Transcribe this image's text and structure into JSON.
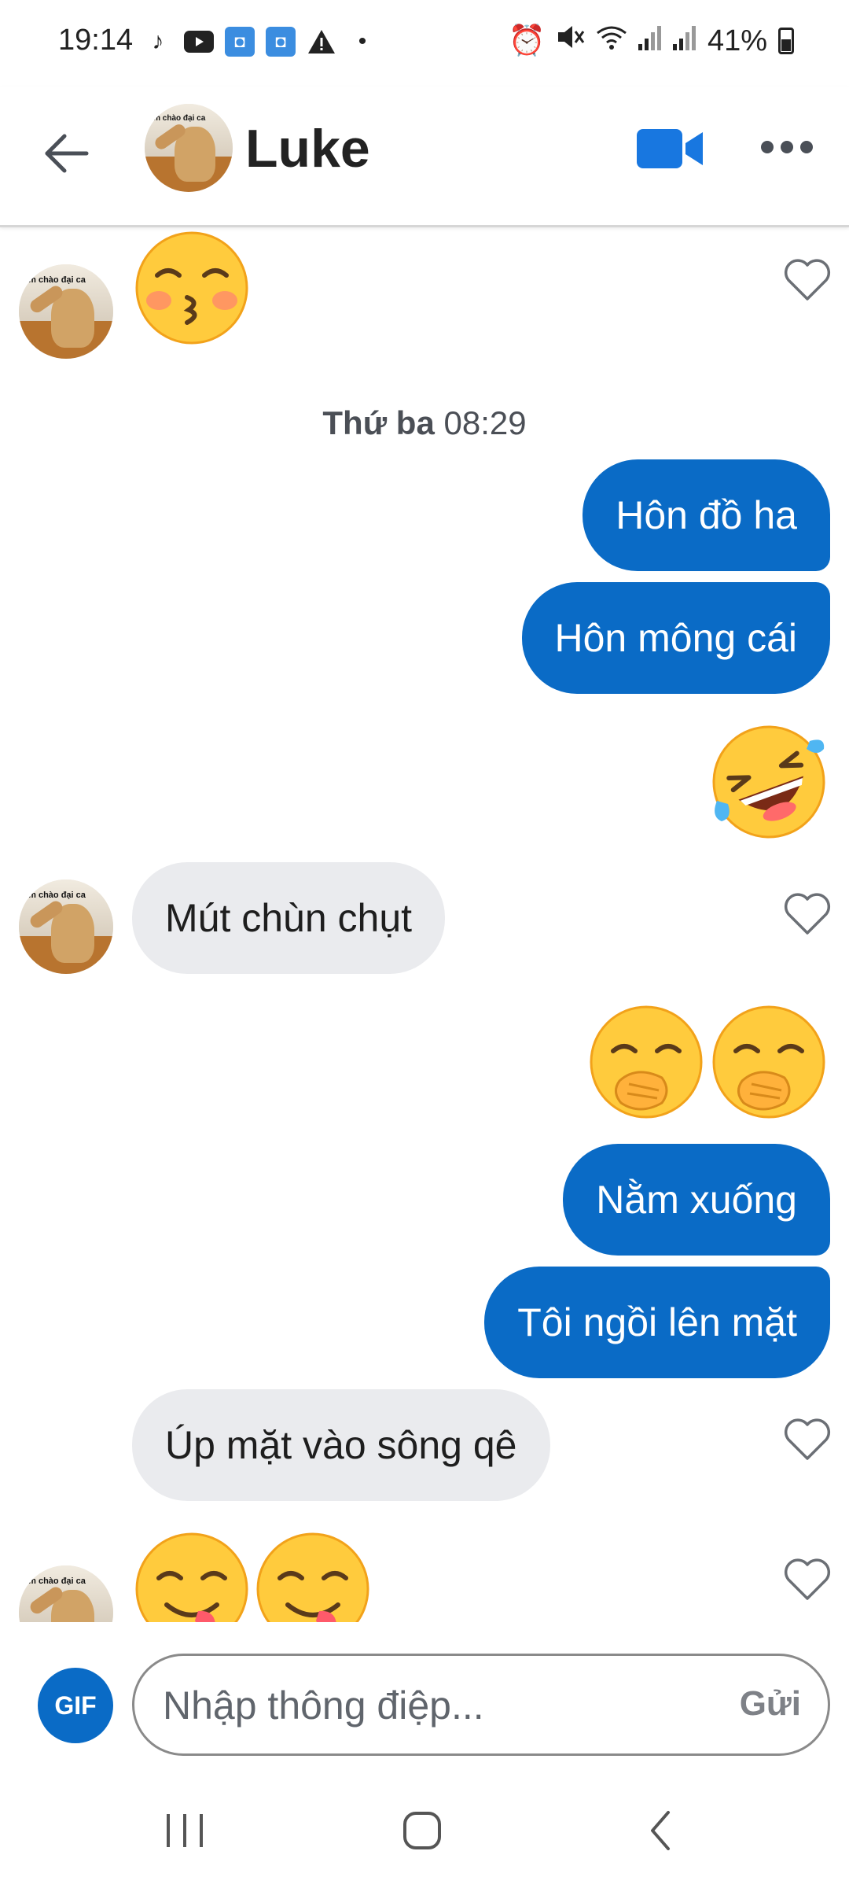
{
  "status_bar": {
    "time": "19:14",
    "battery": "41%",
    "icons": [
      "tiktok-icon",
      "youtube-icon",
      "photo-icon",
      "photo-icon",
      "warning-icon",
      "dot-icon",
      "alarm-icon",
      "mute-icon",
      "wifi-icon",
      "signal-icon",
      "signal-icon",
      "battery-icon"
    ]
  },
  "header": {
    "contact_name": "Luke",
    "avatar_caption": "Em chào đại ca"
  },
  "conversation": {
    "timestamp_day": "Thứ ba",
    "timestamp_time": "08:29",
    "messages": [
      {
        "from": "contact",
        "type": "emoji",
        "content": "kissing-face"
      },
      {
        "from": "me",
        "type": "text",
        "text": "Hôn đồ ha"
      },
      {
        "from": "me",
        "type": "text",
        "text": "Hôn mông cái"
      },
      {
        "from": "me",
        "type": "emoji",
        "content": "rolling-on-floor-laughing"
      },
      {
        "from": "contact",
        "type": "text",
        "text": "Mút chùn chụt"
      },
      {
        "from": "me",
        "type": "emoji",
        "content": "face-with-hand-over-mouth x2"
      },
      {
        "from": "me",
        "type": "text",
        "text": "Nằm xuống"
      },
      {
        "from": "me",
        "type": "text",
        "text": "Tôi ngồi lên mặt"
      },
      {
        "from": "contact",
        "type": "text",
        "text": "Úp mặt vào sông qê"
      },
      {
        "from": "contact",
        "type": "emoji",
        "content": "face-savoring-food x2"
      }
    ]
  },
  "composer": {
    "gif_label": "GIF",
    "placeholder": "Nhập thông điệp...",
    "send_label": "Gửi"
  },
  "colors": {
    "accent": "#0a6bc6",
    "incoming_bubble": "#eaebee"
  }
}
